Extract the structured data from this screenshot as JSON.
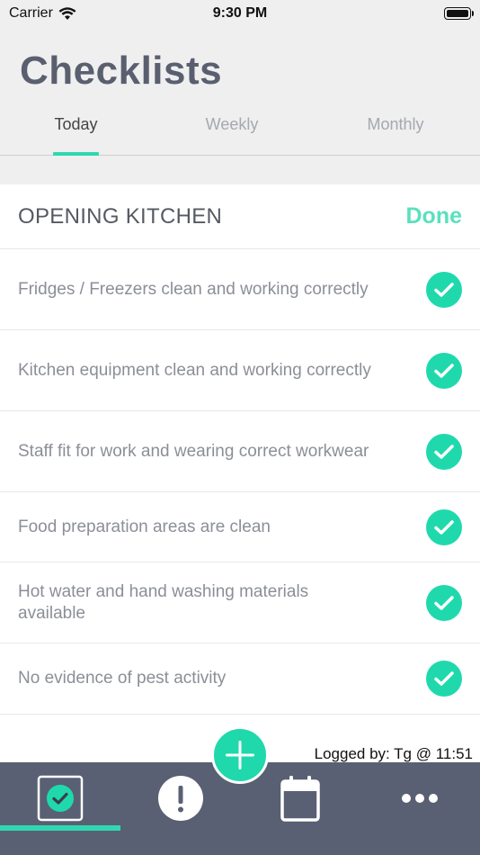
{
  "status_bar": {
    "carrier": "Carrier",
    "time": "9:30 PM"
  },
  "page_title": "Checklists",
  "tabs": [
    {
      "label": "Today",
      "active": true
    },
    {
      "label": "Weekly",
      "active": false
    },
    {
      "label": "Monthly",
      "active": false
    }
  ],
  "checklist": {
    "title": "OPENING KITCHEN",
    "done_label": "Done",
    "items": [
      {
        "text": "Fridges / Freezers clean and working correctly",
        "checked": true
      },
      {
        "text": "Kitchen equipment clean and working correctly",
        "checked": true
      },
      {
        "text": "Staff fit for work and wearing correct workwear",
        "checked": true
      },
      {
        "text": "Food preparation areas are clean",
        "checked": true
      },
      {
        "text": "Hot water and hand washing materials available",
        "checked": true
      },
      {
        "text": "No evidence of pest activity",
        "checked": true
      }
    ]
  },
  "logged_by": "Logged by: Tg @ 11:51",
  "bottom_nav": {
    "items": [
      {
        "icon": "checklist-icon",
        "active": true
      },
      {
        "icon": "alert-icon",
        "active": false
      },
      {
        "icon": "calendar-icon",
        "active": false
      },
      {
        "icon": "more-icon",
        "active": false
      }
    ],
    "fab_icon": "plus-icon"
  },
  "colors": {
    "accent": "#1fd9ad",
    "nav_bar": "#596073",
    "title": "#5a5f70"
  }
}
